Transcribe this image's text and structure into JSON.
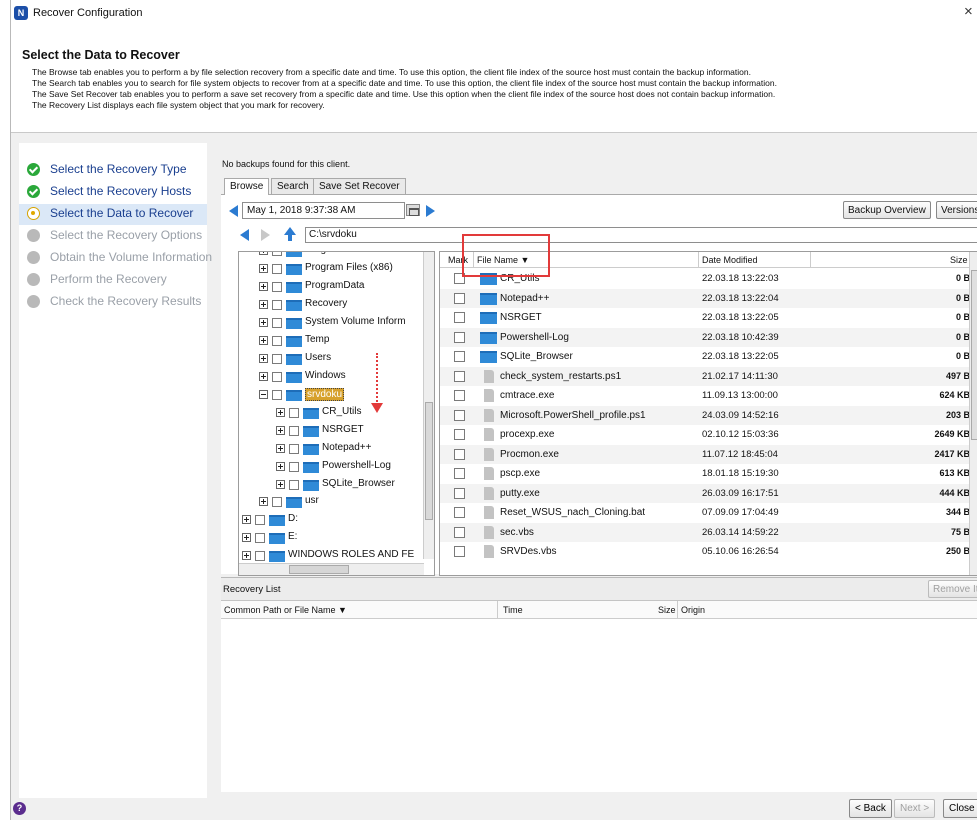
{
  "window": {
    "title": "Recover Configuration",
    "close_glyph": "×",
    "app_icon": "N"
  },
  "header": {
    "heading": "Select the Data to Recover",
    "lines": [
      "The Browse tab enables you to perform a by file selection recovery from a specific date and time. To use this option, the client file index of the source host must contain the backup information.",
      "The Search tab enables you to search for file system objects to recover from at a specific date and time. To use this option, the client file index of the source host must contain the backup information.",
      "The Save Set Recover tab enables you to perform a save set recovery from a specific date and time.  Use this option when the client file index of the source host does not contain backup information.",
      "The Recovery List displays each file system object that you mark for recovery."
    ]
  },
  "wizard": {
    "steps": [
      {
        "label": "Select the Recovery Type",
        "state": "done"
      },
      {
        "label": "Select the Recovery Hosts",
        "state": "done"
      },
      {
        "label": "Select the Data to Recover",
        "state": "current"
      },
      {
        "label": "Select the Recovery Options",
        "state": "pending"
      },
      {
        "label": "Obtain the Volume Information",
        "state": "pending"
      },
      {
        "label": "Perform the Recovery",
        "state": "pending"
      },
      {
        "label": "Check the Recovery Results",
        "state": "pending"
      }
    ]
  },
  "main": {
    "message": "No backups found for this client.",
    "tabs": [
      {
        "label": "Browse",
        "active": true
      },
      {
        "label": "Search",
        "active": false
      },
      {
        "label": "Save Set Recover",
        "active": false
      }
    ],
    "date_value": "May 1, 2018 9:37:38 AM",
    "backup_overview_label": "Backup Overview",
    "versions_label": "Versions",
    "path_value": "C:\\srvdoku"
  },
  "tree": {
    "nodes": [
      {
        "label": "Program Files"
      },
      {
        "label": "Program Files (x86)"
      },
      {
        "label": "ProgramData"
      },
      {
        "label": "Recovery"
      },
      {
        "label": "System Volume Inform"
      },
      {
        "label": "Temp"
      },
      {
        "label": "Users"
      },
      {
        "label": "Windows"
      },
      {
        "label": "srvdoku"
      },
      {
        "label": "CR_Utils"
      },
      {
        "label": "NSRGET"
      },
      {
        "label": "Notepad++"
      },
      {
        "label": "Powershell-Log"
      },
      {
        "label": "SQLite_Browser"
      },
      {
        "label": "usr"
      },
      {
        "label": "D:"
      },
      {
        "label": "E:"
      },
      {
        "label": "WINDOWS ROLES AND FE"
      }
    ]
  },
  "filelist": {
    "columns": {
      "mark": "Mark",
      "name": "File Name ▼",
      "date": "Date Modified",
      "size": "Size"
    },
    "rows": [
      {
        "name": "CR_Utils",
        "date": "22.03.18 13:22:03",
        "size": "0 B",
        "kind": "folder"
      },
      {
        "name": "Notepad++",
        "date": "22.03.18 13:22:04",
        "size": "0 B",
        "kind": "folder"
      },
      {
        "name": "NSRGET",
        "date": "22.03.18 13:22:05",
        "size": "0 B",
        "kind": "folder"
      },
      {
        "name": "Powershell-Log",
        "date": "22.03.18 10:42:39",
        "size": "0 B",
        "kind": "folder"
      },
      {
        "name": "SQLite_Browser",
        "date": "22.03.18 13:22:05",
        "size": "0 B",
        "kind": "folder"
      },
      {
        "name": "check_system_restarts.ps1",
        "date": "21.02.17 14:11:30",
        "size": "497 B",
        "kind": "file"
      },
      {
        "name": "cmtrace.exe",
        "date": "11.09.13 13:00:00",
        "size": "624 KB",
        "kind": "file"
      },
      {
        "name": "Microsoft.PowerShell_profile.ps1",
        "date": "24.03.09 14:52:16",
        "size": "203 B",
        "kind": "file"
      },
      {
        "name": "procexp.exe",
        "date": "02.10.12 15:03:36",
        "size": "2649 KB",
        "kind": "file"
      },
      {
        "name": "Procmon.exe",
        "date": "11.07.12 18:45:04",
        "size": "2417 KB",
        "kind": "file"
      },
      {
        "name": "pscp.exe",
        "date": "18.01.18 15:19:30",
        "size": "613 KB",
        "kind": "file"
      },
      {
        "name": "putty.exe",
        "date": "26.03.09 16:17:51",
        "size": "444 KB",
        "kind": "file"
      },
      {
        "name": "Reset_WSUS_nach_Cloning.bat",
        "date": "07.09.09 17:04:49",
        "size": "344 B",
        "kind": "file"
      },
      {
        "name": "sec.vbs",
        "date": "26.03.14 14:59:22",
        "size": "75 B",
        "kind": "file"
      },
      {
        "name": "SRVDes.vbs",
        "date": "05.10.06 16:26:54",
        "size": "250 B",
        "kind": "file"
      }
    ]
  },
  "recovery_list": {
    "title": "Recovery List",
    "remove_label": "Remove Item",
    "columns": {
      "path": "Common Path or File Name ▼",
      "time": "Time",
      "size": "Size",
      "origin": "Origin"
    }
  },
  "footer": {
    "help_glyph": "?",
    "back_label": "< Back",
    "next_label": "Next >",
    "close_label": "Close"
  },
  "colors": {
    "accent": "#2b7bd1",
    "folder": "#2f8ad7",
    "highlight": "#e23a3a",
    "done": "#2aa83a",
    "current": "#e0a800"
  }
}
